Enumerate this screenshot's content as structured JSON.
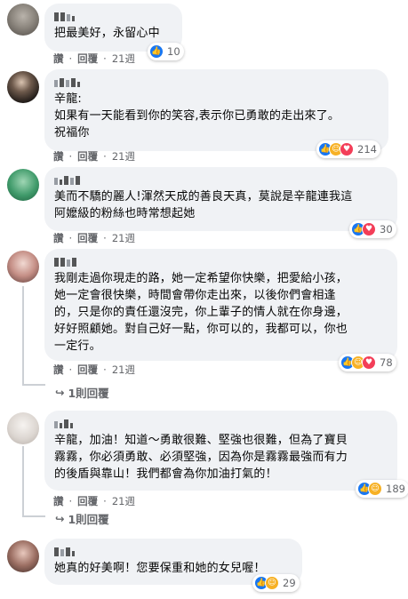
{
  "action_labels": {
    "like": "讚",
    "reply": "回覆"
  },
  "comments": [
    {
      "author": "",
      "text": "把最美好，永留心中",
      "time": "21週",
      "reaction_count": "10",
      "reactions": [
        "like-icon"
      ]
    },
    {
      "author": "",
      "text": "辛龍:\n如果有一天能看到你的笑容,表示你已勇敢的走出來了。\n祝福你",
      "time": "21週",
      "reaction_count": "214",
      "reactions": [
        "like-icon",
        "haha-icon",
        "love-icon"
      ]
    },
    {
      "author": "",
      "text": "美而不驕的麗人!渾然天成的善良天真，莫說是辛龍連我這\n阿嬤級的粉絲也時常想起她",
      "time": "21週",
      "reaction_count": "30",
      "reactions": [
        "like-icon",
        "love-icon"
      ]
    },
    {
      "author": "",
      "text": "我剛走過你現走的路，她一定希望你快樂，把愛給小孩，\n她一定會很快樂，時間會帶你走出來，以後你們會相逢\n的，只是你的責任還沒完，你上輩子的情人就在你身邊，\n好好照顧她。對自己好一點，你可以的，我都可以，你也\n一定行。",
      "time": "21週",
      "reaction_count": "78",
      "reactions": [
        "like-icon",
        "haha-icon",
        "love-icon"
      ],
      "replies_label": "1則回覆"
    },
    {
      "author": "",
      "text": "辛龍，加油！知道～勇敢很難、堅強也很難，但為了寶貝\n霧霧，你必須勇敢、必須堅強，因為你是霧霧最強而有力\n的後盾與靠山！我們都會為你加油打氣的！",
      "time": "21週",
      "reaction_count": "189",
      "reactions": [
        "like-icon",
        "haha-icon"
      ],
      "replies_label": "1則回覆"
    },
    {
      "author": "",
      "text": "她真的好美啊！您要保重和她的女兒喔！",
      "time": "",
      "reaction_count": "29",
      "reactions": [
        "like-icon",
        "haha-icon"
      ]
    }
  ],
  "colors": {
    "bubble": "#f0f2f5",
    "like": "#1877f2",
    "haha": "#f7b125",
    "love": "#f33e58",
    "meta_text": "#65676b"
  }
}
